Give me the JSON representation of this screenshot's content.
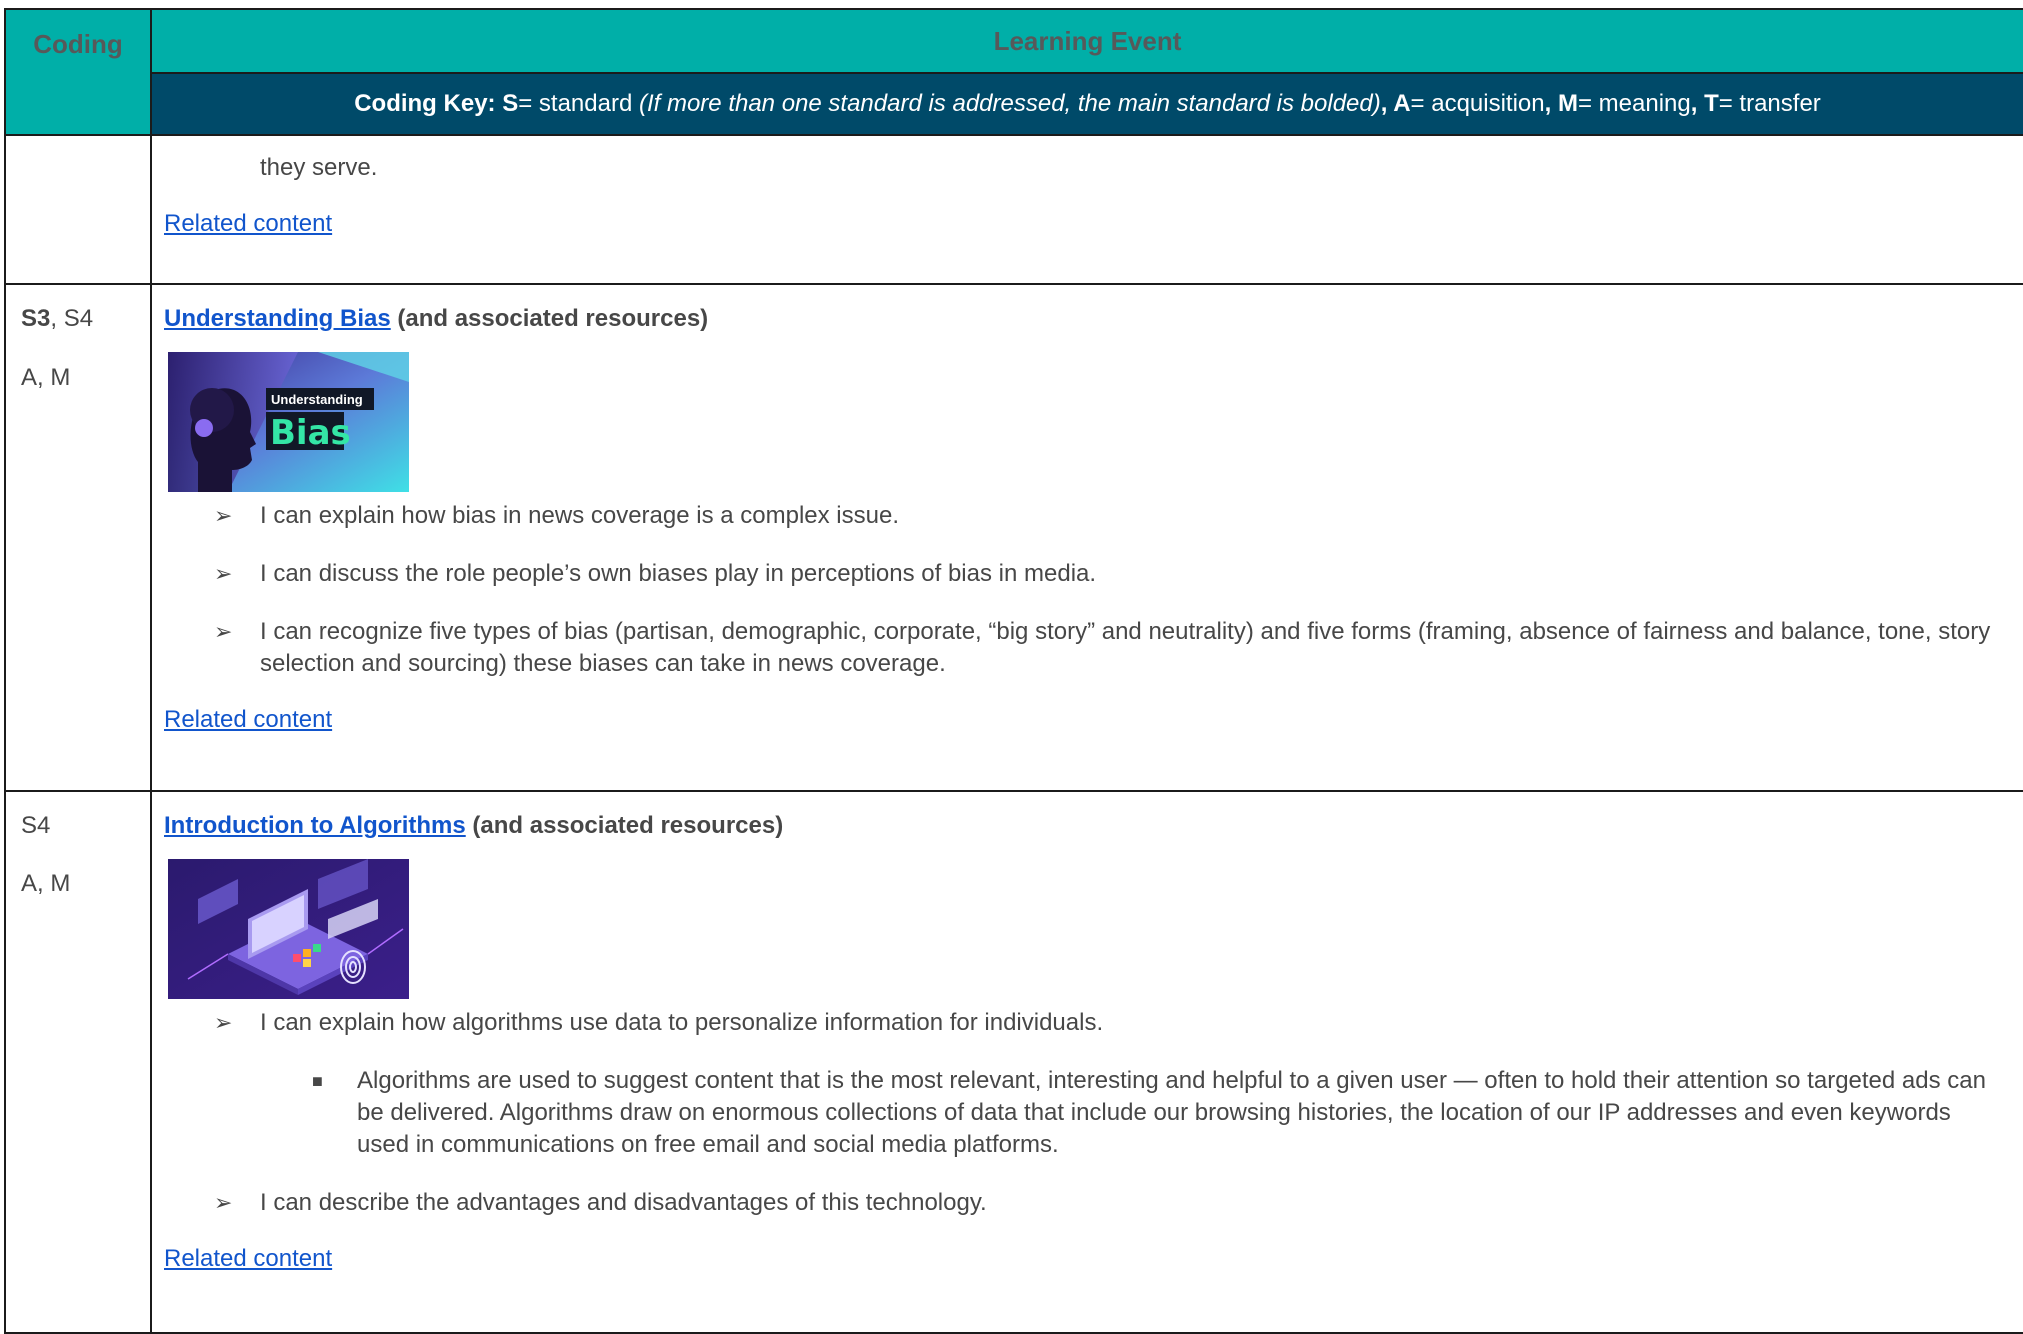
{
  "header": {
    "coding": "Coding",
    "event": "Learning Event",
    "key": {
      "label": "Coding Key:",
      "s_letter": "S",
      "s_text": "= standard ",
      "s_note": "(If more than one standard is addressed, the main standard is bolded)",
      "a_sep": ", ",
      "a_letter": "A",
      "a_text": "= acquisition",
      "m_sep": ", ",
      "m_letter": "M",
      "m_text": "= meaning",
      "t_sep": ", ",
      "t_letter": "T",
      "t_text": "= transfer"
    }
  },
  "row0": {
    "continued_text": "they serve.",
    "related": "Related content"
  },
  "row1": {
    "code_primary": "S3",
    "code_rest": ", S4",
    "code_aspects": "A, M",
    "title_link": "Understanding Bias",
    "title_suffix": " (and associated resources)",
    "thumb_text_small": "Understanding",
    "thumb_text_big": "Bias",
    "bullets": [
      "I can explain how bias in news coverage is a complex issue.",
      "I can discuss the role people’s own biases play in perceptions of bias in media.",
      "I can recognize five types of bias (partisan, demographic, corporate, “big story” and neutrality) and five forms (framing, absence of fairness and balance, tone, story selection and sourcing) these biases can take in news coverage."
    ],
    "related": "Related content"
  },
  "row2": {
    "code_primary": "S4",
    "code_aspects": "A, M",
    "title_link": "Introduction to Algorithms",
    "title_suffix": " (and associated resources)",
    "bullets": [
      "I can explain how algorithms use data to personalize information for individuals.",
      "I can describe the advantages and disadvantages of this technology."
    ],
    "sub_bullet": "Algorithms are used to suggest content that is the most relevant, interesting and helpful to a given user — often to hold their attention so targeted ads can be delivered. Algorithms draw on enormous collections of data that include our browsing histories, the location of our IP addresses and even keywords used in communications on free email and social media platforms.",
    "related": "Related content"
  },
  "glyphs": {
    "arrow": "➢",
    "square": "■"
  },
  "colors": {
    "header_teal": "#00afa8",
    "header_navy": "#004a69",
    "link_blue": "#1155cc",
    "body_text": "#474747"
  }
}
